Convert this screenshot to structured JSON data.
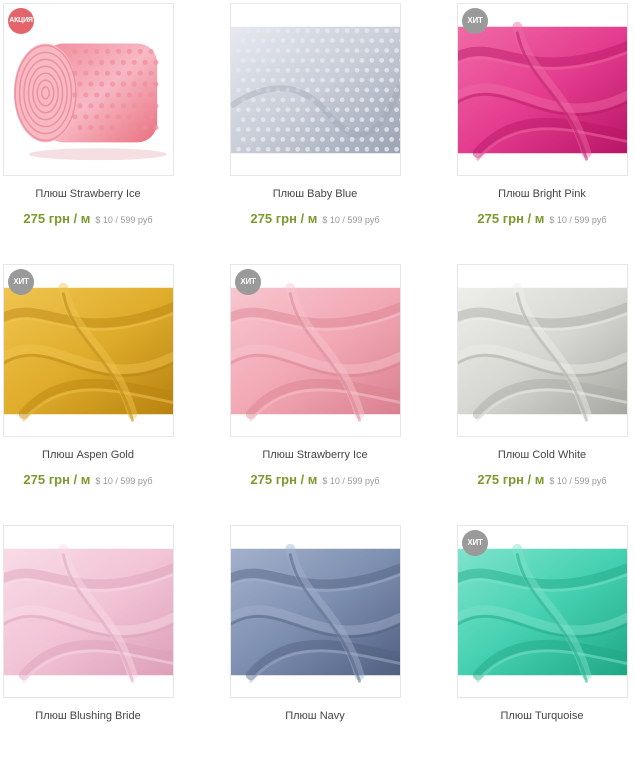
{
  "products": [
    {
      "name": "Плюш Strawberry Ice",
      "price": "275 грн / м",
      "alt_price": "$ 10 / 599 руб",
      "badge": "АКЦИЯ",
      "badge_type": "sale",
      "image": "roll",
      "colors": [
        "#f7b9c4",
        "#e9707f",
        "#f08d9c"
      ]
    },
    {
      "name": "Плюш Baby Blue",
      "price": "275 грн / м",
      "alt_price": "$ 10 / 599 руб",
      "badge": "",
      "badge_type": "",
      "image": "minky",
      "colors": [
        "#c9ced8",
        "#9aa3b3",
        "#e6e9ef"
      ]
    },
    {
      "name": "Плюш Bright Pink",
      "price": "275 грн / м",
      "alt_price": "$ 10 / 599 руб",
      "badge": "ХИТ",
      "badge_type": "hit",
      "image": "folds",
      "colors": [
        "#e53d8f",
        "#b81566",
        "#f06aa6"
      ]
    },
    {
      "name": "Плюш Aspen Gold",
      "price": "275 грн / м",
      "alt_price": "$ 10 / 599 руб",
      "badge": "ХИТ",
      "badge_type": "hit",
      "image": "folds",
      "colors": [
        "#e0ad2c",
        "#b8820f",
        "#efc550"
      ]
    },
    {
      "name": "Плюш Strawberry Ice",
      "price": "275 грн / м",
      "alt_price": "$ 10 / 599 руб",
      "badge": "ХИТ",
      "badge_type": "hit",
      "image": "folds",
      "colors": [
        "#f2a9b5",
        "#d9808f",
        "#f7c6cf"
      ]
    },
    {
      "name": "Плюш Cold White",
      "price": "275 грн / м",
      "alt_price": "$ 10 / 599 руб",
      "badge": "",
      "badge_type": "",
      "image": "folds",
      "colors": [
        "#d7d7d3",
        "#a7a7a2",
        "#eeeeea"
      ]
    },
    {
      "name": "Плюш Blushing Bride",
      "price": "",
      "alt_price": "",
      "badge": "",
      "badge_type": "",
      "image": "folds",
      "colors": [
        "#f2c4d6",
        "#dc9fb8",
        "#f8dbe6"
      ]
    },
    {
      "name": "Плюш Navy",
      "price": "",
      "alt_price": "",
      "badge": "",
      "badge_type": "",
      "image": "folds",
      "colors": [
        "#7d8fb1",
        "#4f5f80",
        "#a3b1cb"
      ]
    },
    {
      "name": "Плюш Turquoise",
      "price": "",
      "alt_price": "",
      "badge": "ХИТ",
      "badge_type": "hit",
      "image": "folds",
      "colors": [
        "#45d1b1",
        "#1fa785",
        "#7fe3cb"
      ]
    }
  ]
}
